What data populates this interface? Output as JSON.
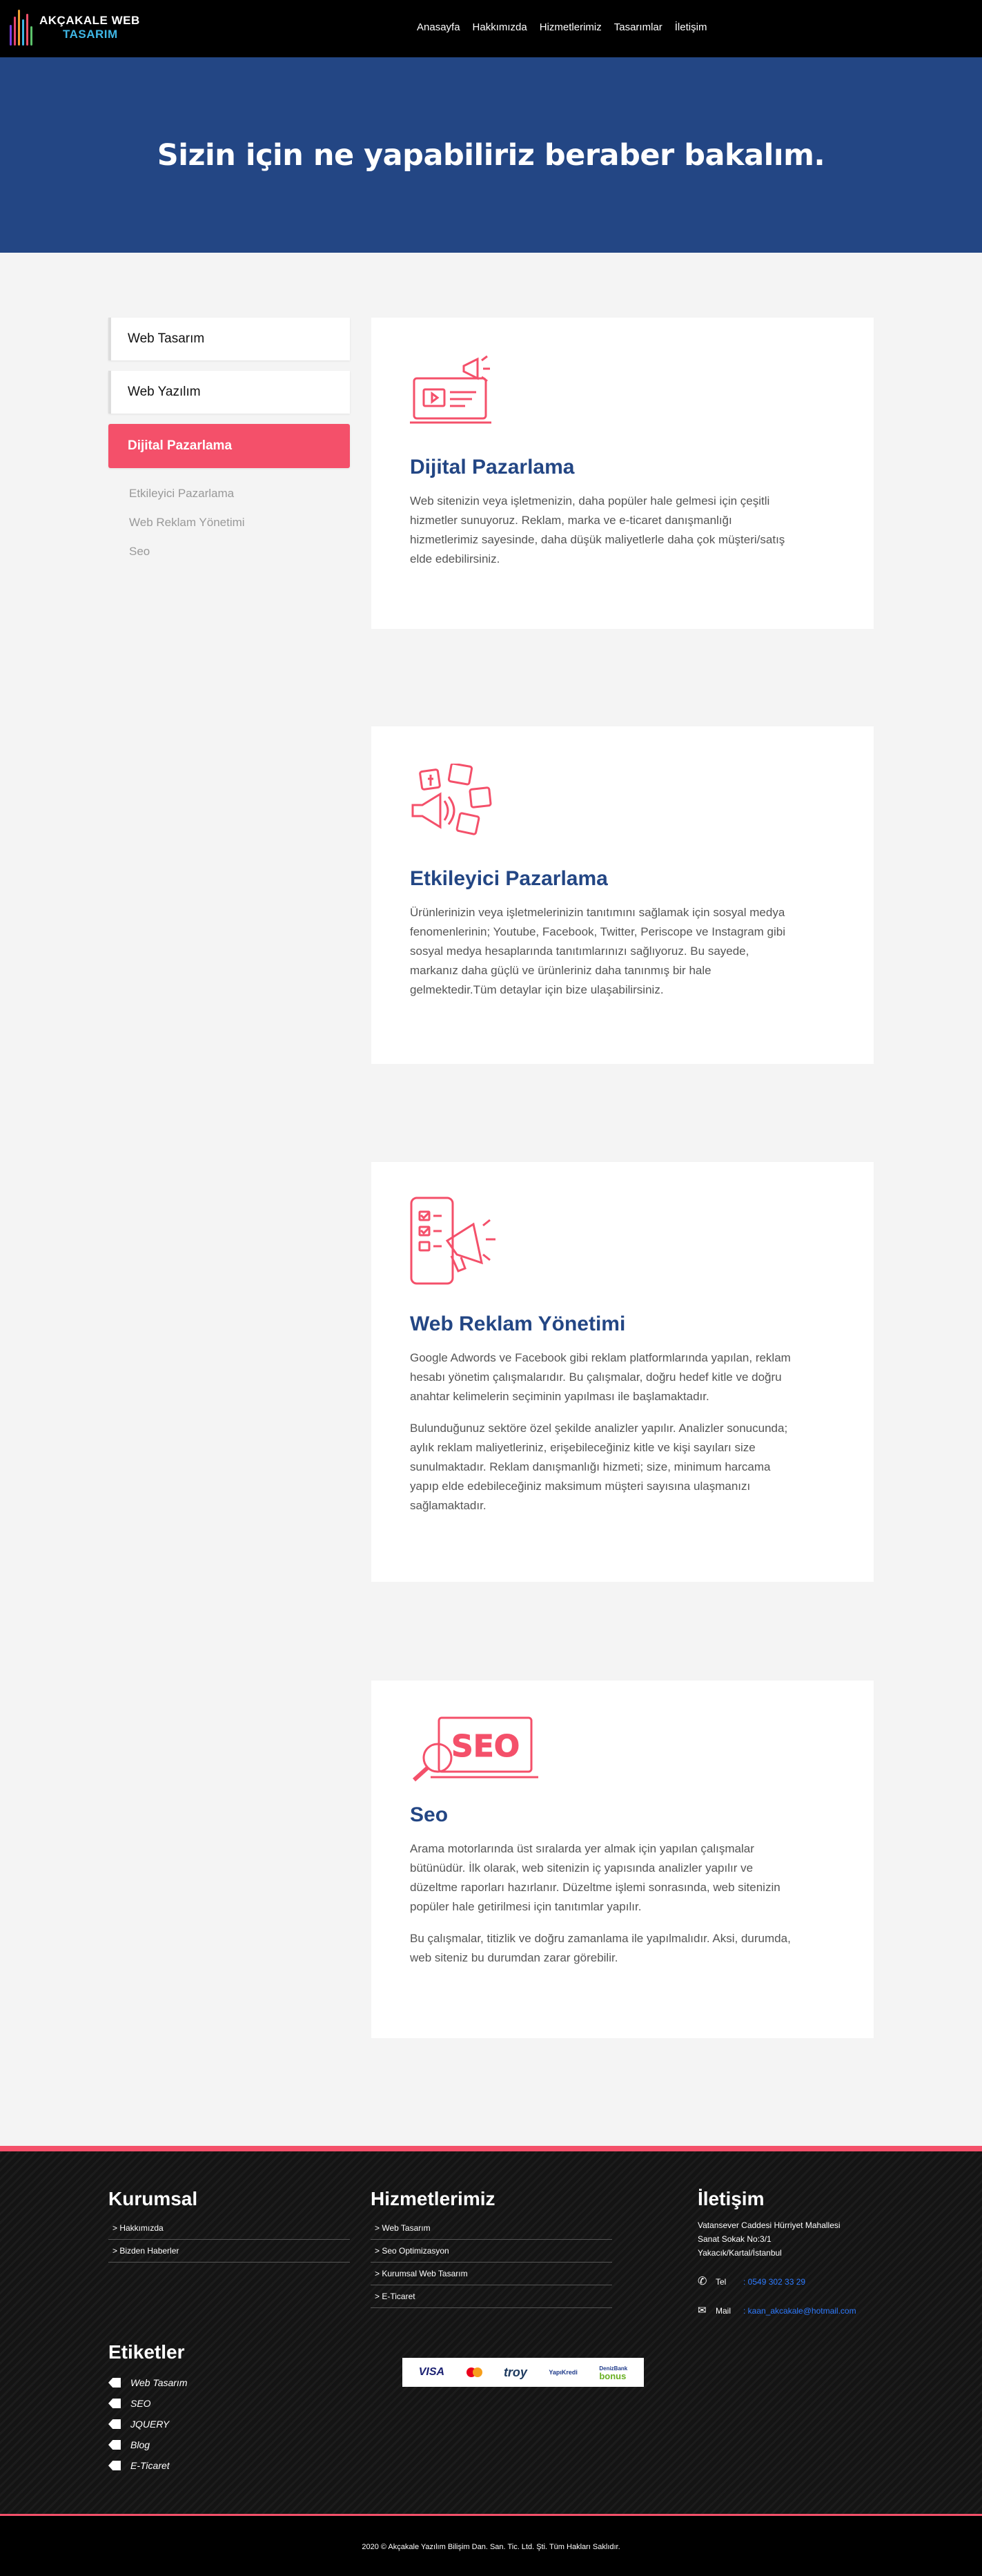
{
  "header": {
    "logo_line1": "AKÇAKALE WEB",
    "logo_line2": "TASARIM",
    "nav": [
      "Anasayfa",
      "Hakkımızda",
      "Hizmetlerimiz",
      "Tasarımlar",
      "İletişim"
    ]
  },
  "hero": {
    "title": "Sizin için ne yapabiliriz beraber bakalım."
  },
  "sidebar": {
    "items": [
      "Web Tasarım",
      "Web Yazılım",
      "Dijital Pazarlama"
    ],
    "active_index": 2,
    "sub_items": [
      "Etkileyici Pazarlama",
      "Web Reklam Yönetimi",
      "Seo"
    ]
  },
  "cards": [
    {
      "icon": "laptop-megaphone-icon",
      "title": "Dijital Pazarlama",
      "paragraphs": [
        "Web sitenizin veya işletmenizin, daha popüler hale gelmesi için çeşitli hizmetler sunuyoruz. Reklam, marka ve e-ticaret danışmanlığı hizmetlerimiz sayesinde, daha düşük maliyetlerle daha çok müşteri/satış elde edebilirsiniz."
      ]
    },
    {
      "icon": "social-media-icon",
      "title": "Etkileyici Pazarlama",
      "paragraphs": [
        "Ürünlerinizin veya işletmelerinizin tanıtımını sağlamak için sosyal medya fenomenlerinin; Youtube, Facebook, Twitter, Periscope ve Instagram gibi sosyal medya hesaplarında tanıtımlarınızı sağlıyoruz. Bu sayede, markanız daha güçlü ve ürünleriniz daha tanınmış bir hale gelmektedir.Tüm detaylar için bize ulaşabilirsiniz."
      ]
    },
    {
      "icon": "phone-megaphone-icon",
      "title": "Web Reklam Yönetimi",
      "paragraphs": [
        "Google Adwords ve Facebook gibi reklam platformlarında yapılan, reklam hesabı yönetim çalışmalarıdır. Bu çalışmalar, doğru hedef kitle ve doğru anahtar kelimelerin seçiminin yapılması ile başlamaktadır.",
        "Bulunduğunuz sektöre özel şekilde analizler yapılır. Analizler sonucunda; aylık reklam maliyetleriniz, erişebileceğiniz kitle ve kişi sayıları size sunulmaktadır. Reklam danışmanlığı hizmeti; size, minimum harcama yapıp elde edebileceğiniz maksimum müşteri sayısına ulaşmanızı sağlamaktadır."
      ]
    },
    {
      "icon": "seo-magnifier-icon",
      "icon_text": "SEO",
      "title": "Seo",
      "paragraphs": [
        "Arama motorlarında üst sıralarda yer almak için yapılan çalışmalar bütünüdür. İlk olarak, web sitenizin iç yapısında analizler yapılır ve düzeltme raporları hazırlanır. Düzeltme işlemi sonrasında, web sitenizin popüler hale getirilmesi için tanıtımlar yapılır.",
        "Bu çalışmalar, titizlik ve doğru zamanlama ile yapılmalıdır. Aksi, durumda, web siteniz bu durumdan zarar görebilir."
      ]
    }
  ],
  "footer": {
    "kurumsal": {
      "title": "Kurumsal",
      "links": [
        "> Hakkımızda",
        "> Bizden Haberler"
      ]
    },
    "hizmetler": {
      "title": "Hizmetlerimiz",
      "links": [
        "> Web Tasarım",
        "> Seo Optimizasyon",
        "> Kurumsal Web Tasarım",
        "> E-Ticaret"
      ]
    },
    "iletisim": {
      "title": "İletişim",
      "address": [
        "Vatansever Caddesi Hürriyet Mahallesi",
        "Sanat Sokak No:3/1",
        "Yakacık/Kartal/İstanbul"
      ],
      "tel_label": "Tel",
      "tel": ": 0549 302 33 29",
      "mail_label": "Mail",
      "mail": ": kaan_akcakale@hotmail.com"
    },
    "etiketler": {
      "title": "Etiketler",
      "tags": [
        "Web Tasarım",
        "SEO",
        "JQUERY",
        "Blog",
        "E-Ticaret"
      ]
    },
    "payments": [
      "VISA",
      "troy",
      "YapıKredi",
      "DenizBank",
      "bonus"
    ],
    "copyright": "2020 © Akçakale Yazılım Bilişim Dan. San. Tic. Ltd. Şti. Tüm Hakları Saklıdır."
  },
  "colors": {
    "accent": "#f4506a",
    "brand_blue": "#234684",
    "header_bg": "#000000"
  }
}
